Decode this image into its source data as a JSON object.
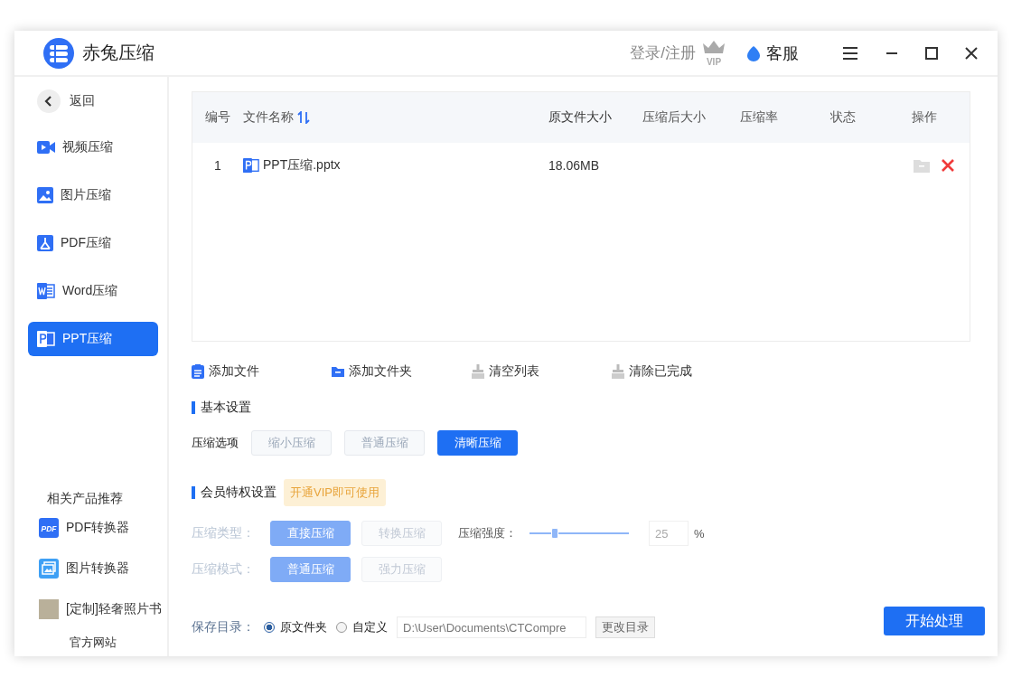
{
  "app": {
    "title": "赤兔压缩"
  },
  "header": {
    "login": "登录/注册",
    "vip": "VIP",
    "support": "客服"
  },
  "sidebar": {
    "back": "返回",
    "items": [
      {
        "label": "视频压缩",
        "kind": "video",
        "selected": false
      },
      {
        "label": "图片压缩",
        "kind": "image",
        "selected": false
      },
      {
        "label": "PDF压缩",
        "kind": "pdf",
        "selected": false
      },
      {
        "label": "Word压缩",
        "kind": "word",
        "selected": false
      },
      {
        "label": "PPT压缩",
        "kind": "ppt",
        "selected": true
      }
    ],
    "related_title": "相关产品推荐",
    "products": [
      {
        "label": "PDF转换器",
        "kind": "pdf",
        "icon_text": "PDF"
      },
      {
        "label": "图片转换器",
        "kind": "image"
      },
      {
        "label": "[定制]轻奢照片书",
        "kind": "photo"
      }
    ],
    "website": "官方网站"
  },
  "table": {
    "columns": [
      "编号",
      "文件名称",
      "原文件大小",
      "压缩后大小",
      "压缩率",
      "状态",
      "操作"
    ],
    "rows": [
      {
        "index": "1",
        "name": "PPT压缩.pptx",
        "size": "18.06MB"
      }
    ]
  },
  "toolbar": [
    {
      "label": "添加文件",
      "kind": "file"
    },
    {
      "label": "添加文件夹",
      "kind": "folder"
    },
    {
      "label": "清空列表",
      "kind": "broom"
    },
    {
      "label": "清除已完成",
      "kind": "broom"
    }
  ],
  "basic": {
    "title": "基本设置",
    "label": "压缩选项",
    "options": [
      {
        "label": "缩小压缩",
        "selected": false
      },
      {
        "label": "普通压缩",
        "selected": false
      },
      {
        "label": "清晰压缩",
        "selected": true
      }
    ]
  },
  "member": {
    "title": "会员特权设置",
    "badge": "开通VIP即可使用",
    "disabled": true,
    "type_label": "压缩类型：",
    "types": [
      {
        "label": "直接压缩",
        "selected": true
      },
      {
        "label": "转换压缩",
        "selected": false
      }
    ],
    "strength_label": "压缩强度：",
    "strength": {
      "level": 0.25
    },
    "strength_value": "25",
    "unit": "%",
    "mode_label": "压缩模式：",
    "modes": [
      {
        "label": "普通压缩",
        "selected": true
      },
      {
        "label": "强力压缩",
        "selected": false
      }
    ]
  },
  "save": {
    "label": "保存目录：",
    "options": [
      {
        "label": "原文件夹",
        "selected": true
      },
      {
        "label": "自定义",
        "selected": false
      }
    ],
    "path": "D:\\User\\Documents\\CTCompre",
    "change": "更改目录"
  },
  "start": "开始处理"
}
